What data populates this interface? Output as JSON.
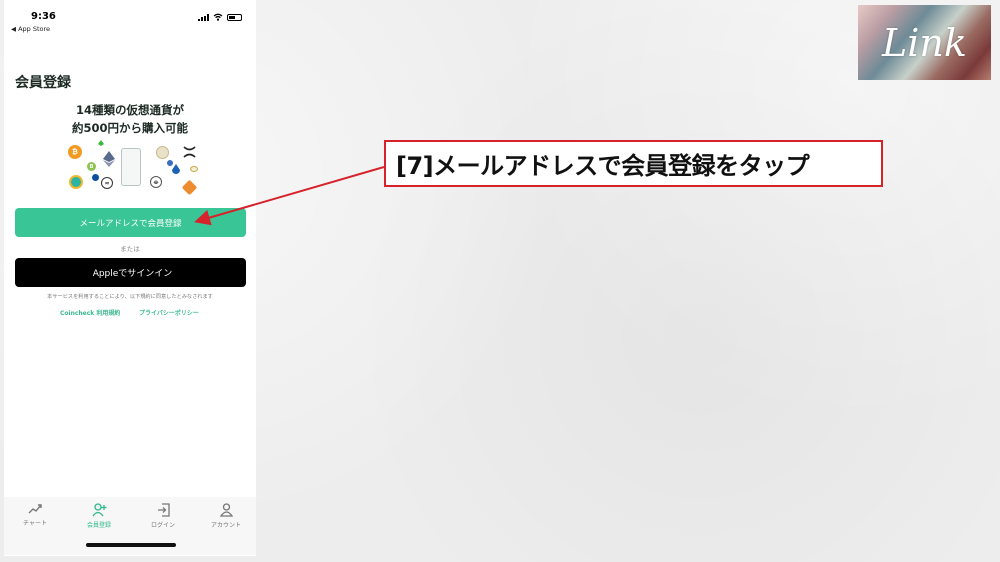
{
  "status_bar": {
    "time": "9:36",
    "back_label": "◀ App Store"
  },
  "page": {
    "title": "会員登録",
    "headline_line1": "14種類の仮想通貨が",
    "headline_line2": "約500円から購入可能"
  },
  "buttons": {
    "email_signup": "メールアドレスで会員登録",
    "or_text": "または",
    "apple_signin": "Appleでサインイン"
  },
  "legal": {
    "agree_text": "本サービスを利用することにより、以下規約に同意したとみなされます",
    "terms_link": "Coincheck 利用規約",
    "privacy_link": "プライバシーポリシー"
  },
  "tabs": [
    {
      "label": "チャート",
      "icon": "chart-icon",
      "active": false
    },
    {
      "label": "会員登録",
      "icon": "add-user-icon",
      "active": true
    },
    {
      "label": "ログイン",
      "icon": "login-icon",
      "active": false
    },
    {
      "label": "アカウント",
      "icon": "account-icon",
      "active": false
    }
  ],
  "annotation": {
    "text": "[7]メールアドレスで会員登録をタップ",
    "color": "#d6222a"
  },
  "logo": {
    "text": "Link"
  },
  "colors": {
    "accent": "#39c596",
    "apple_button": "#000000"
  }
}
